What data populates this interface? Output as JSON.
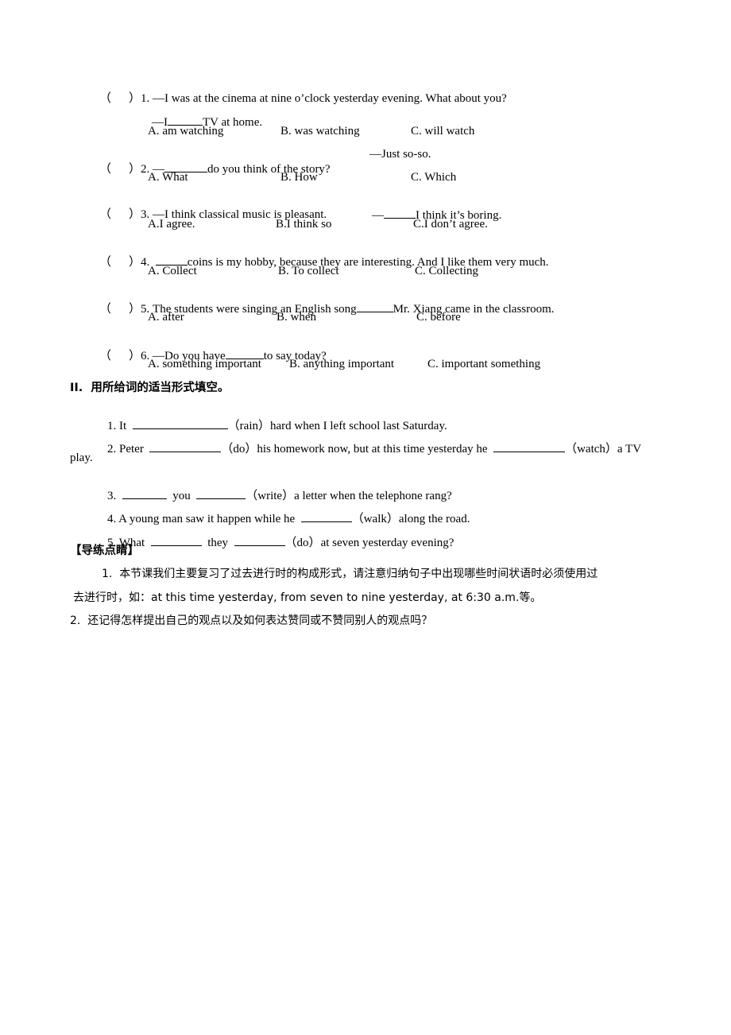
{
  "section1": {
    "questions": [
      {
        "bracket_open": "（",
        "bracket_close": "）",
        "number": "1.",
        "line1_pre": "—I was at the cinema at nine o’clock yesterday evening. What about you?",
        "line2_pre": "—I",
        "line2_post": "TV at home.",
        "options": [
          "A. am watching",
          "B. was watching",
          "C. will watch"
        ]
      },
      {
        "bracket_open": "（",
        "bracket_close": "）",
        "number": "2.",
        "line1_pre": "—",
        "line1_post": "do you think of the story?",
        "reply": "—Just so-so.",
        "options": [
          "A. What",
          "B. How",
          "C. Which"
        ]
      },
      {
        "bracket_open": "（",
        "bracket_close": "）",
        "number": "3.",
        "line1_pre": "—I think classical music is pleasant.",
        "reply_pre": "—",
        "reply_post": "I think it’s boring.",
        "options": [
          "A.I agree.",
          "B.I think so",
          "C.I don’t agree."
        ]
      },
      {
        "bracket_open": "（",
        "bracket_close": "）",
        "number": "4.",
        "line1_post": "coins is my hobby, because they are interesting. And I like them very much.",
        "options": [
          "A. Collect",
          "B. To collect",
          "C. Collecting"
        ]
      },
      {
        "bracket_open": "（",
        "bracket_close": "）",
        "number": "5.",
        "line1_pre": "The students were singing an English song",
        "line1_post": "Mr. Xiang came in the classroom.",
        "options": [
          "A. after",
          "B. when",
          "C. before"
        ]
      },
      {
        "bracket_open": "（",
        "bracket_close": "）",
        "number": "6.",
        "line1_pre": "—Do you have",
        "line1_post": "to say today?",
        "options": [
          "A. something important",
          "B. anything important",
          "C. important something"
        ]
      }
    ]
  },
  "section2": {
    "heading": "II.  用所给词的适当形式填空。",
    "items": [
      {
        "number": "1. It",
        "hint": "（rain）",
        "post": "hard when I left school last Saturday."
      },
      {
        "number": "2. Peter",
        "hint1": "（do）",
        "mid": "his homework now, but at this time yesterday he",
        "hint2": "（watch）",
        "post": "a TV",
        "wrap": "play."
      },
      {
        "number": "3.",
        "mid": "you",
        "hint": "（write）",
        "post": "a letter when the telephone rang?"
      },
      {
        "number": "4. A young man saw it happen while he",
        "hint": "（walk）",
        "post": "along the road."
      },
      {
        "number": "5. What",
        "mid": "they",
        "hint": "（do）",
        "post": "at seven yesterday evening?"
      }
    ]
  },
  "guide": {
    "heading": "【导练点睛】",
    "point1_line1": "1.  本节课我们主要复习了过去进行时的构成形式，请注意归纳句子中出现哪些时间状语时必须使用过",
    "point1_line2": "去进行时，如：at this time yesterday, from seven to nine yesterday, at 6:30 a.m.等。",
    "point2": "2.  还记得怎样提出自己的观点以及如何表达赞同或不赞同别人的观点吗？"
  }
}
